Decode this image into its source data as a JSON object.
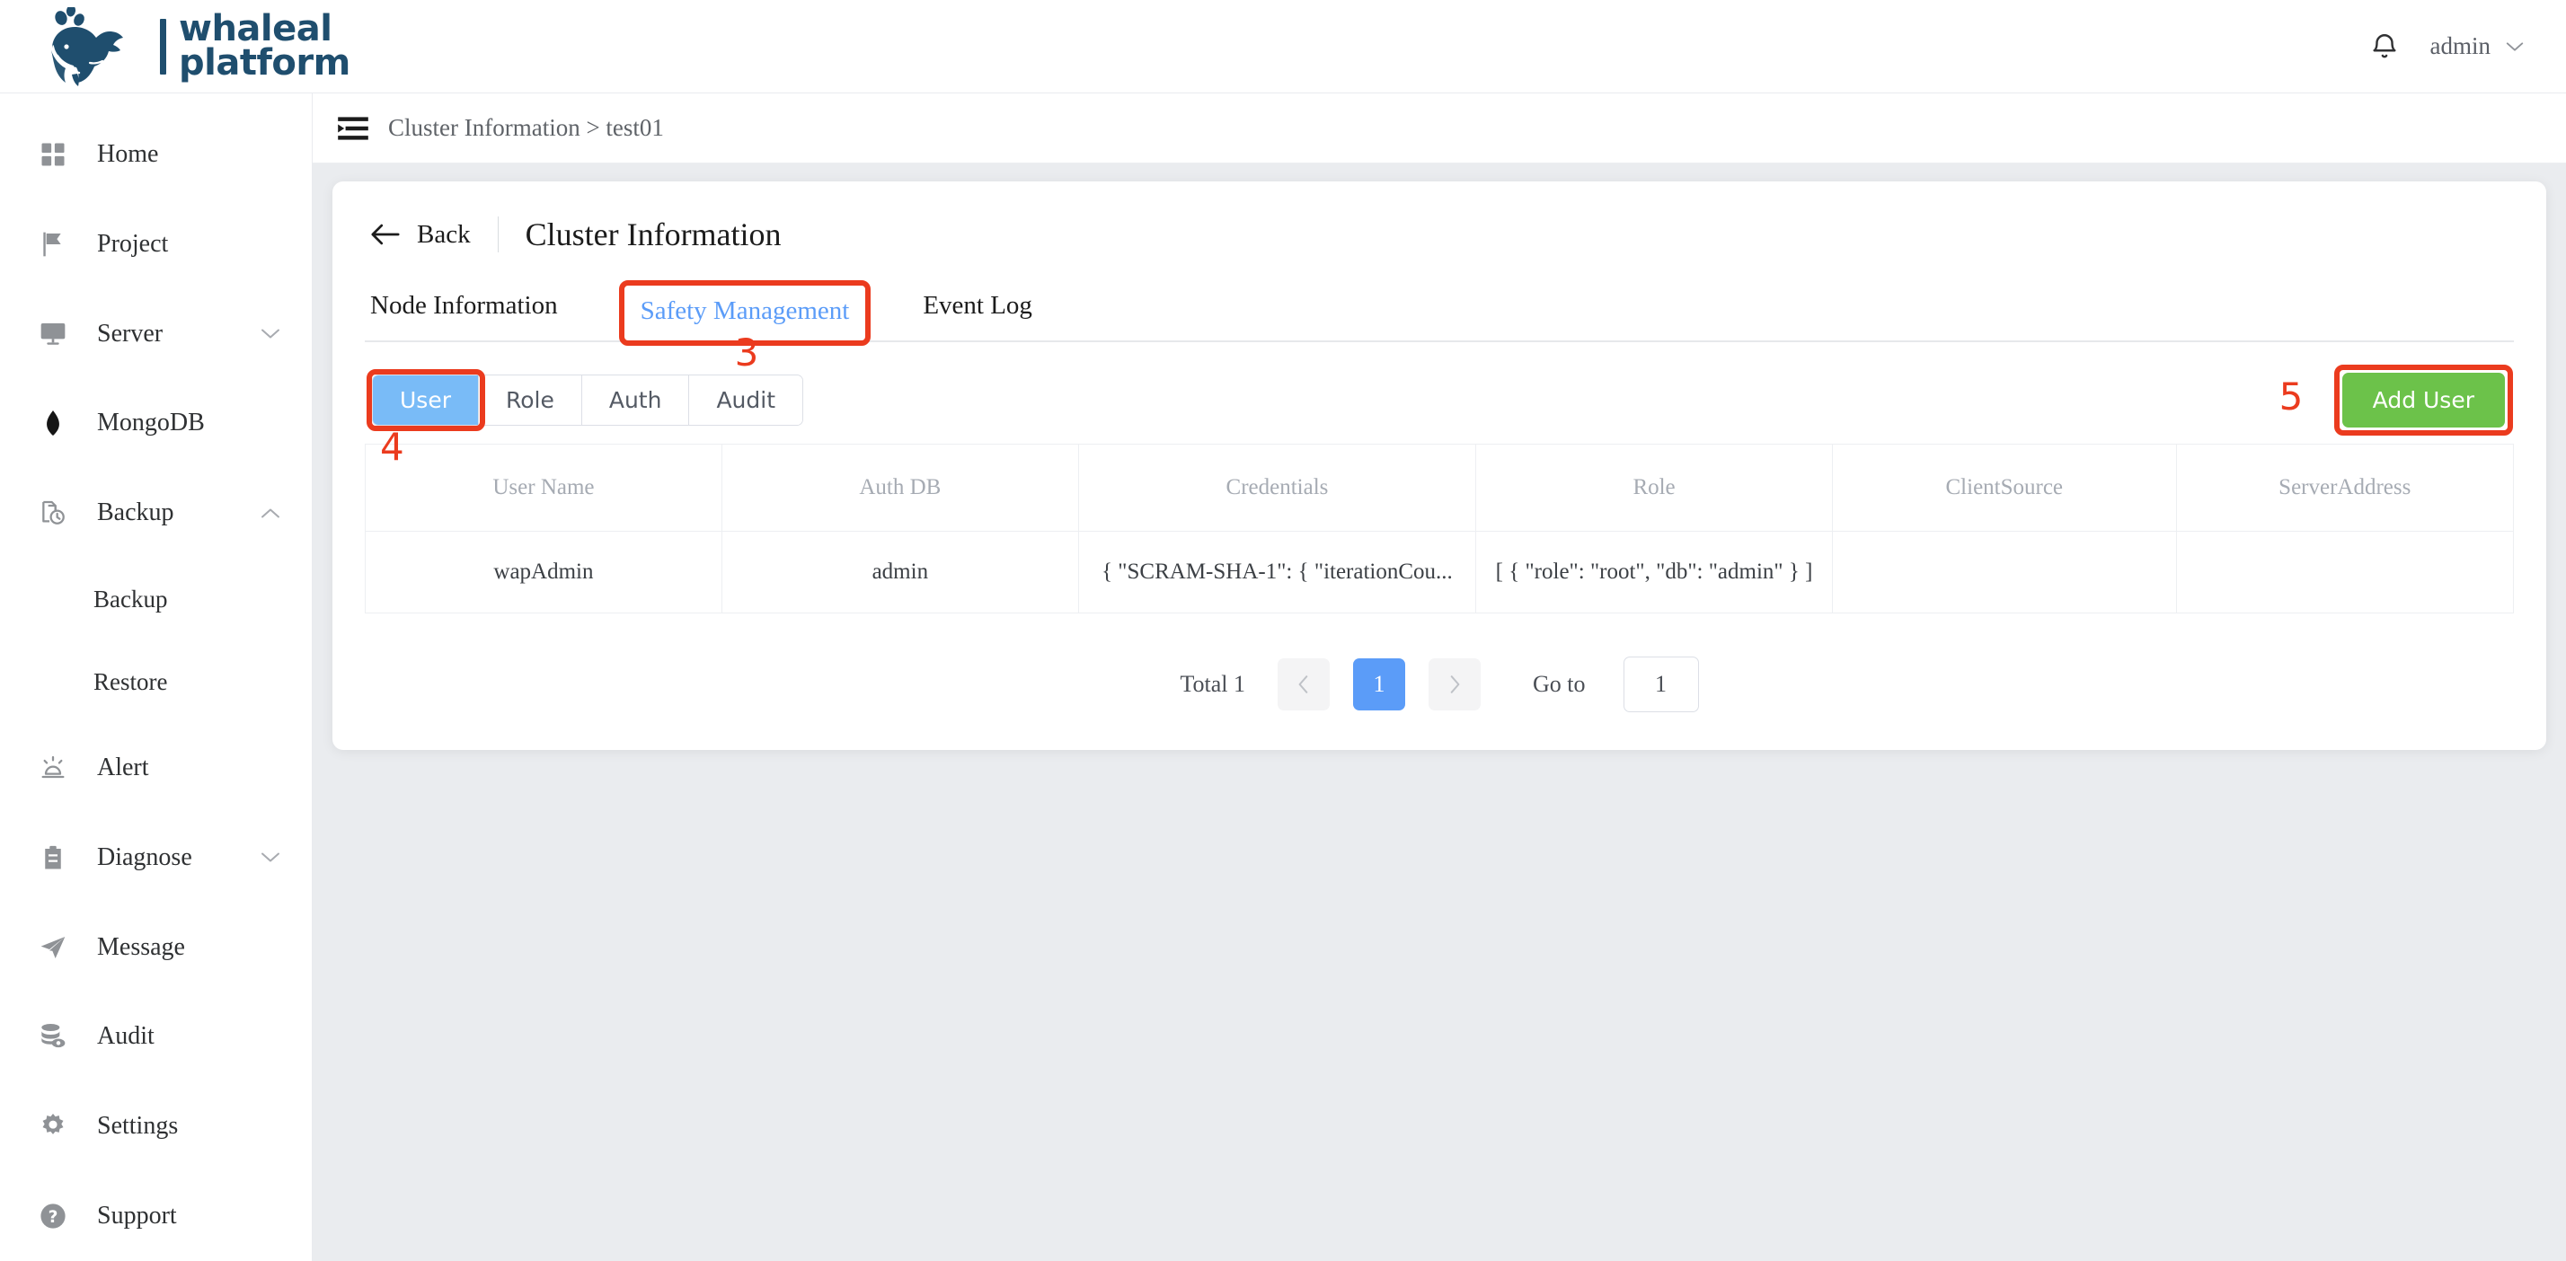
{
  "brand": {
    "line1": "whaleal",
    "line2": "platform",
    "color": "#1f4e6e"
  },
  "topbar": {
    "bell_icon": "bell-icon",
    "user_name": "admin",
    "caret_icon": "chevron-down-icon"
  },
  "sidebar": {
    "items": [
      {
        "label": "Home",
        "icon": "grid-icon",
        "chevron": ""
      },
      {
        "label": "Project",
        "icon": "flag-icon",
        "chevron": ""
      },
      {
        "label": "Server",
        "icon": "monitor-icon",
        "chevron": "down"
      },
      {
        "label": "MongoDB",
        "icon": "mongodb-leaf-icon",
        "chevron": ""
      },
      {
        "label": "Backup",
        "icon": "backup-clock-icon",
        "chevron": "up"
      }
    ],
    "backup_children": [
      {
        "label": "Backup"
      },
      {
        "label": "Restore"
      }
    ],
    "items_after": [
      {
        "label": "Alert",
        "icon": "siren-icon",
        "chevron": ""
      },
      {
        "label": "Diagnose",
        "icon": "clipboard-icon",
        "chevron": "down"
      },
      {
        "label": "Message",
        "icon": "paper-plane-icon",
        "chevron": ""
      },
      {
        "label": "Audit",
        "icon": "database-eye-icon",
        "chevron": ""
      },
      {
        "label": "Settings",
        "icon": "gear-icon",
        "chevron": ""
      },
      {
        "label": "Support",
        "icon": "question-circle-icon",
        "chevron": ""
      }
    ]
  },
  "breadcrumb": {
    "menu_icon": "collapse-menu-icon",
    "text": "Cluster Information > test01"
  },
  "card": {
    "back_label": "Back",
    "back_icon": "arrow-left-icon",
    "title": "Cluster Information"
  },
  "tabs": [
    {
      "label": "Node Information",
      "active": false
    },
    {
      "label": "Safety Management",
      "active": true
    },
    {
      "label": "Event Log",
      "active": false
    }
  ],
  "subtabs": [
    {
      "label": "User",
      "active": true
    },
    {
      "label": "Role",
      "active": false
    },
    {
      "label": "Auth",
      "active": false
    },
    {
      "label": "Audit",
      "active": false
    }
  ],
  "add_user_label": "Add User",
  "table": {
    "columns": [
      "User Name",
      "Auth DB",
      "Credentials",
      "Role",
      "ClientSource",
      "ServerAddress"
    ],
    "rows": [
      {
        "user_name": "wapAdmin",
        "auth_db": "admin",
        "credentials": "{ \"SCRAM-SHA-1\": { \"iterationCou...",
        "role": "[ { \"role\": \"root\", \"db\": \"admin\" } ]",
        "client_source": "",
        "server_address": ""
      }
    ]
  },
  "pagination": {
    "total_label": "Total 1",
    "prev_icon": "chevron-left-icon",
    "current_page": "1",
    "next_icon": "chevron-right-icon",
    "goto_label": "Go to",
    "goto_value": "1"
  },
  "annotations": [
    {
      "id": "3",
      "target": "safety-management-tab"
    },
    {
      "id": "4",
      "target": "user-subtab"
    },
    {
      "id": "5",
      "target": "add-user-button"
    }
  ],
  "colors": {
    "accent_blue": "#5b9cf8",
    "subtab_blue": "#79bbf7",
    "add_green": "#6cc24a",
    "annotation_red": "#eb3b1e",
    "brand_navy": "#1f4e6e",
    "page_bg": "#eaecef"
  }
}
